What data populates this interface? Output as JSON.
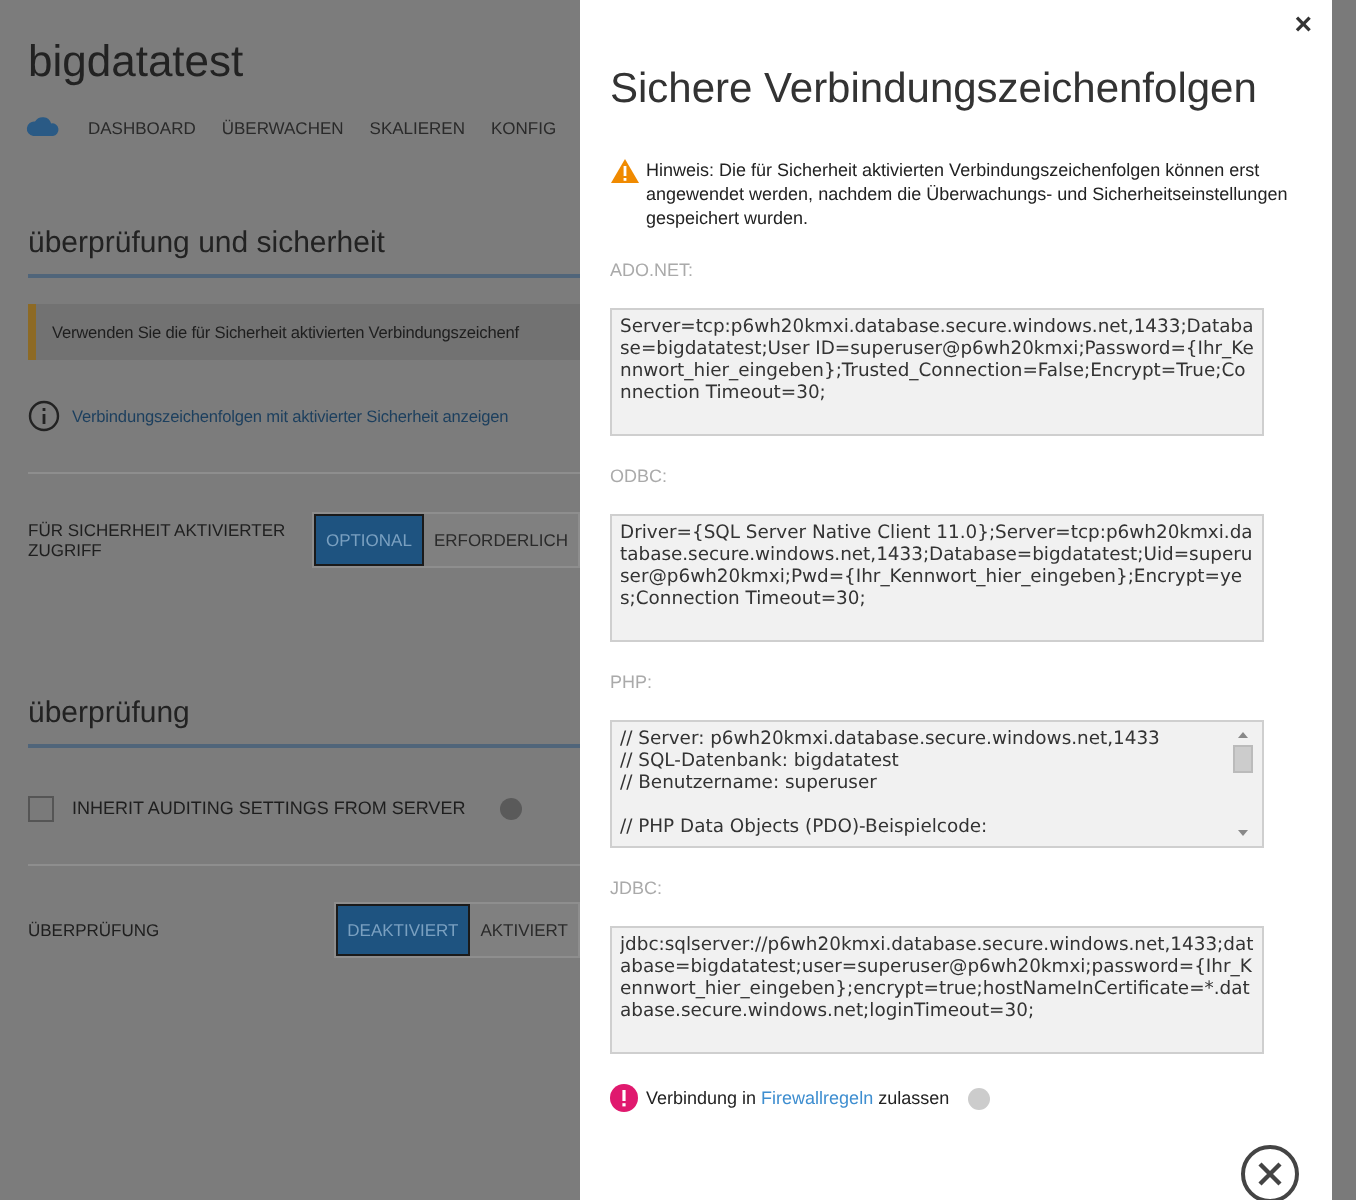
{
  "page": {
    "title": "bigdatatest",
    "nav": [
      "DASHBOARD",
      "ÜBERWACHEN",
      "SKALIEREN",
      "KONFIG"
    ],
    "security_heading": "überprüfung und sicherheit",
    "banner": "Verwenden Sie die für Sicherheit aktivierten Verbindungszeichenf",
    "info_link": "Verbindungszeichenfolgen mit aktivierter Sicherheit anzeigen",
    "access_setting": {
      "label": "FÜR SICHERHEIT AKTIVIERTER ZUGRIFF",
      "options": [
        {
          "label": "OPTIONAL",
          "selected": true
        },
        {
          "label": "ERFORDERLICH",
          "selected": false
        }
      ]
    },
    "audit_heading": "überprüfung",
    "inherit_checkbox": {
      "label": "INHERIT AUDITING SETTINGS FROM SERVER",
      "checked": false
    },
    "audit_setting": {
      "label": "ÜBERPRÜFUNG",
      "options": [
        {
          "label": "DEAKTIVIERT",
          "selected": true
        },
        {
          "label": "AKTIVIERT",
          "selected": false
        }
      ]
    }
  },
  "dialog": {
    "close": "×",
    "title": "Sichere Verbindungszeichenfolgen",
    "notice": "Hinweis: Die für Sicherheit aktivierten Verbindungszeichenfolgen können erst angewendet werden, nachdem die Überwachungs- und Sicherheitseinstellungen gespeichert wurden.",
    "connection_strings": [
      {
        "label": "ADO.NET:",
        "value": "Server=tcp:p6wh20kmxi.database.secure.windows.net,1433;Database=bigdatatest;User ID=superuser@p6wh20kmxi;Password={Ihr_Kennwort_hier_eingeben};Trusted_Connection=False;Encrypt=True;Connection Timeout=30;",
        "scrollable": false
      },
      {
        "label": "ODBC:",
        "value": "Driver={SQL Server Native Client 11.0};Server=tcp:p6wh20kmxi.database.secure.windows.net,1433;Database=bigdatatest;Uid=superuser@p6wh20kmxi;Pwd={Ihr_Kennwort_hier_eingeben};Encrypt=yes;Connection Timeout=30;",
        "scrollable": false
      },
      {
        "label": "PHP:",
        "value": "// Server: p6wh20kmxi.database.secure.windows.net,1433\n// SQL-Datenbank: bigdatatest\n// Benutzername: superuser\n\n// PHP Data Objects (PDO)-Beispielcode:",
        "scrollable": true
      },
      {
        "label": "JDBC:",
        "value": "jdbc:sqlserver://p6wh20kmxi.database.secure.windows.net,1433;database=bigdatatest;user=superuser@p6wh20kmxi;password={Ihr_Kennwort_hier_eingeben};encrypt=true;hostNameInCertificate=*.database.secure.windows.net;loginTimeout=30;",
        "scrollable": false
      }
    ],
    "firewall": {
      "before": "Verbindung in",
      "link": "Firewallregeln",
      "after": "zulassen"
    }
  }
}
